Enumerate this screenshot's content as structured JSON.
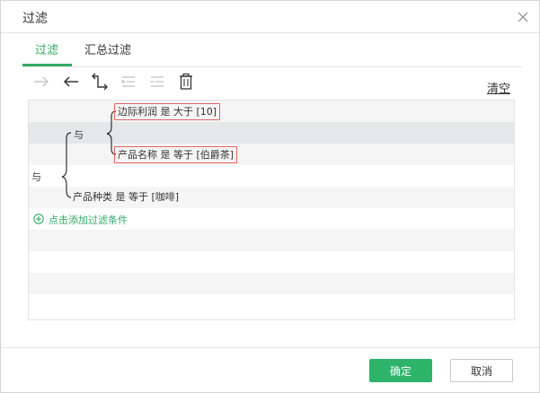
{
  "dialog": {
    "title": "过滤",
    "close_icon": "close-icon"
  },
  "tabs": [
    {
      "label": "过滤",
      "active": true
    },
    {
      "label": "汇总过滤",
      "active": false
    }
  ],
  "toolbar": {
    "icons": [
      "arrow-right-icon",
      "arrow-left-icon",
      "swap-icon",
      "indent-icon",
      "outdent-icon",
      "trash-icon"
    ],
    "clear_label": "清空"
  },
  "filter_tree": {
    "root_operator": "与",
    "group_operator": "与",
    "conditions": [
      {
        "text": "边际利润 是 大于 [10]",
        "highlighted": true
      },
      {
        "text": "产品名称 是 等于 [伯爵茶]",
        "highlighted": true
      },
      {
        "text": "产品种类 是 等于 [咖啡]",
        "highlighted": false
      }
    ],
    "add_condition_label": "点击添加过滤条件"
  },
  "footer": {
    "ok_label": "确定",
    "cancel_label": "取消"
  },
  "colors": {
    "accent": "#33aa66",
    "highlight_border": "#e06565",
    "row_highlight": "#e5e8e8"
  }
}
